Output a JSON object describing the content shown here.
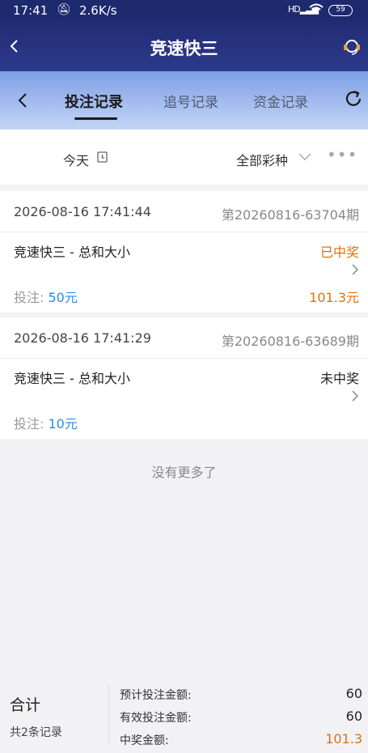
{
  "status_bar": {
    "time": "17:41",
    "speed": "2.6K/s",
    "signal": "HD",
    "battery": "59"
  },
  "header": {
    "title": "竞速快三"
  },
  "tabs": [
    {
      "label": "投注记录",
      "active": true
    },
    {
      "label": "追号记录",
      "active": false
    },
    {
      "label": "资金记录",
      "active": false
    }
  ],
  "filter": {
    "date": "今天",
    "game": "全部彩种",
    "more": "•••"
  },
  "records": [
    {
      "datetime": "2026-08-16 17:41:44",
      "issue": "第20260816-63704期",
      "game": "竞速快三 - 总和大小",
      "status": "已中奖",
      "bet_label": "投注: ",
      "bet_amount": "50元",
      "win_amount": "101.3元"
    },
    {
      "datetime": "2026-08-16 17:41:29",
      "issue": "第20260816-63689期",
      "game": "竞速快三 - 总和大小",
      "status": "未中奖",
      "bet_label": "投注: ",
      "bet_amount": "10元",
      "win_amount": ""
    }
  ],
  "no_more": "没有更多了",
  "summary": {
    "total_label": "合计",
    "count_label": "共2条记录",
    "expected_bet_label": "预计投注金额:",
    "expected_bet_value": "60",
    "valid_bet_label": "有效投注金额:",
    "valid_bet_value": "60",
    "win_label": "中奖金额:",
    "win_value": "101.3"
  },
  "colors": {
    "header_bg": "#222c73",
    "accent_orange": "#e07010",
    "accent_blue": "#2a8ee0"
  }
}
